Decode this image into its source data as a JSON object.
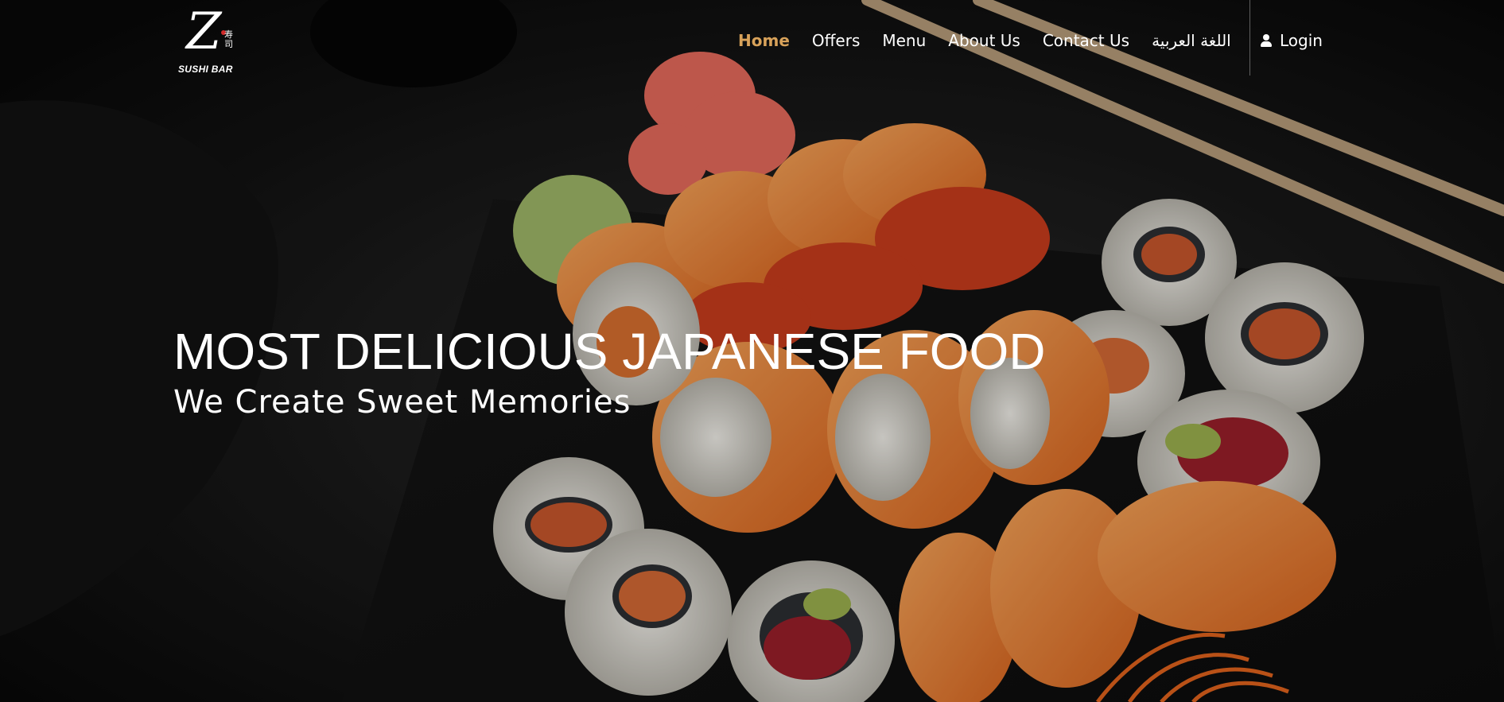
{
  "logo": {
    "mark": "Z",
    "kanji": "寿司",
    "text": "SUSHI BAR"
  },
  "nav": {
    "items": [
      {
        "label": "Home",
        "active": true
      },
      {
        "label": "Offers",
        "active": false
      },
      {
        "label": "Menu",
        "active": false
      },
      {
        "label": "About Us",
        "active": false
      },
      {
        "label": "Contact Us",
        "active": false
      },
      {
        "label": "اللغة العربية",
        "active": false
      }
    ],
    "login_label": "Login"
  },
  "hero": {
    "title": "MOST DELICIOUS JAPANESE FOOD",
    "subtitle": "We Create Sweet Memories"
  },
  "colors": {
    "accent": "#d8a25a",
    "text": "#ffffff",
    "background": "#0a0a0a"
  },
  "icons": {
    "login": "user-icon"
  }
}
